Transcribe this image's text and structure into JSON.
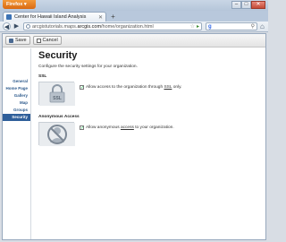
{
  "browser": {
    "menu_button": "Firefox",
    "tab_title": "Center for Hawaii Island Analysis",
    "new_tab": "+",
    "url_prefix": "arcgistutorials.maps.",
    "url_domain": "arcgis.com",
    "url_path": "/home/organization.html",
    "search_engine": "Google"
  },
  "toolbar": {
    "save_label": "Save",
    "cancel_label": "Cancel"
  },
  "sidebar": {
    "items": [
      {
        "label": "General"
      },
      {
        "label": "Home Page"
      },
      {
        "label": "Gallery"
      },
      {
        "label": "Map"
      },
      {
        "label": "Groups"
      },
      {
        "label": "Security",
        "active": true
      }
    ]
  },
  "main": {
    "title": "Security",
    "description": "Configure the security settings for your organization.",
    "ssl": {
      "heading": "SSL",
      "option_before": "Allow access to the organization through ",
      "option_link": "SSL",
      "option_after": " only.",
      "checked": true,
      "thumb_caption": "SSL"
    },
    "anonymous": {
      "heading": "Anonymous Access",
      "option_before": "Allow anonymous ",
      "option_link": "access",
      "option_after": " to your organization.",
      "checked": true
    }
  },
  "colors": {
    "accent": "#2f5f9a",
    "firefox_orange": "#e8801f"
  }
}
